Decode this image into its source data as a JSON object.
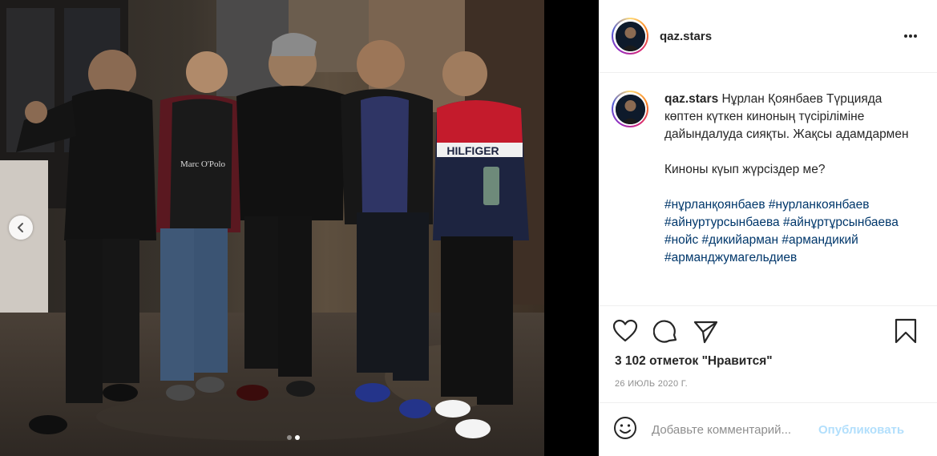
{
  "post": {
    "username": "qaz.stars",
    "caption_user": "qaz.stars",
    "caption_line1": "Нұрлан Қоянбаев Түрцияда көптен күткен киноның түсіріліміне дайындалуда сияқты. Жақсы адамдармен",
    "caption_line2": "Киноны күып жүрсіздер ме?",
    "hashtags": [
      "#нұрланқоянбаев",
      "#нурланкоянбаев",
      "#айнуртурсынбаева",
      "#айнұртұрсынбаева",
      "#нойс",
      "#дикийарман",
      "#армандикий",
      "#арманджумагельдиев"
    ],
    "likes": "3 102 отметок \"Нравится\"",
    "date": "26 ИЮЛЬ 2020 Г.",
    "comment_placeholder": "Добавьте комментарий...",
    "publish_label": "Опубликовать"
  },
  "photo": {
    "shirt_text": "Marc O'Polo",
    "sweater_text": "HILFIGER"
  },
  "carousel": {
    "total": 2,
    "active": 2
  },
  "colors": {
    "link": "#00376b",
    "publish_disabled": "#b2dffc",
    "muted": "#8e8e8e"
  },
  "icons": [
    "chevron-left-icon",
    "more-icon",
    "heart-icon",
    "comment-icon",
    "share-icon",
    "bookmark-icon",
    "smiley-icon"
  ]
}
